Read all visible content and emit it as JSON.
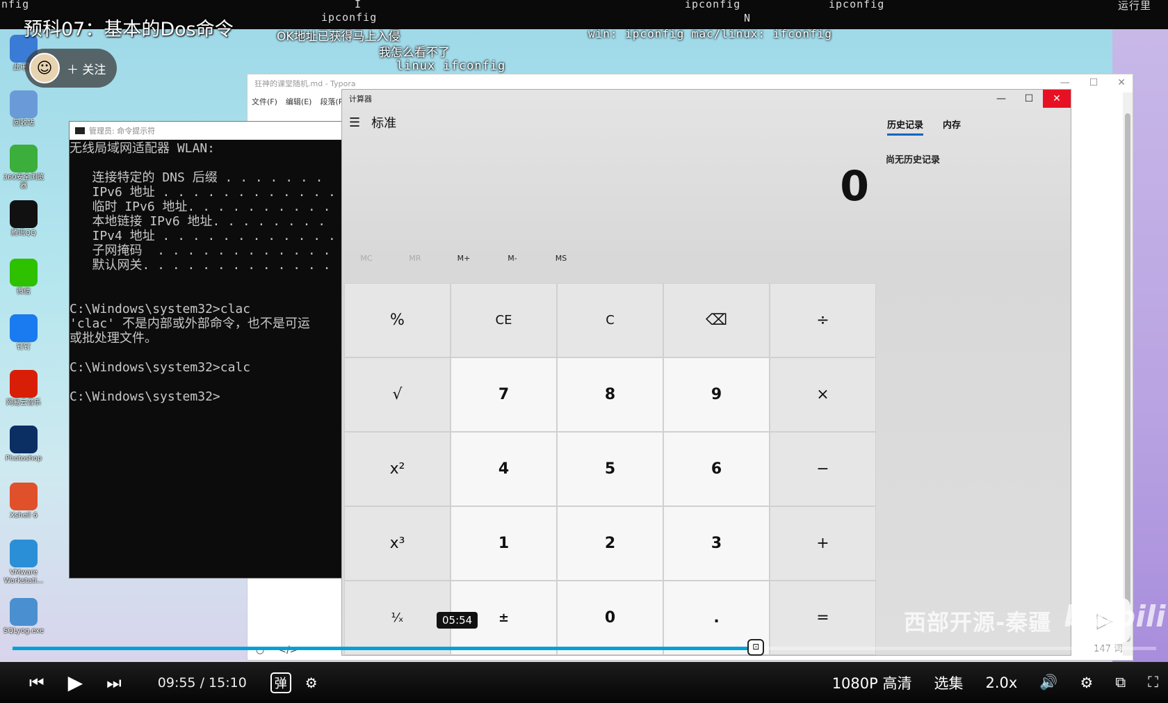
{
  "top_fragments": [
    "nfig",
    "I",
    "ipconfig",
    "ipconfig",
    "N",
    "ipconfig",
    "运行里"
  ],
  "video": {
    "title": "预科07：基本的Dos命令",
    "follow_label": "关注",
    "subtitle_1": "OK地址已获得马上入侵",
    "subtitle_2": "我怎么看不了",
    "subtitle_3": "linux ifconfig",
    "subtitle_4": "win: ipconfig mac/linux: ifconfig"
  },
  "desktop_icons": [
    {
      "label": "此电脑",
      "icon": "computer-icon",
      "color": "#3a7bd5"
    },
    {
      "label": "回收站",
      "icon": "recycle-bin-icon",
      "color": "#6a9bd8"
    },
    {
      "label": "360安全浏览器",
      "icon": "browser-icon",
      "color": "#3cae3c"
    },
    {
      "label": "腾讯QQ",
      "icon": "qq-icon",
      "color": "#111111"
    },
    {
      "label": "微信",
      "icon": "wechat-icon",
      "color": "#2dc100"
    },
    {
      "label": "钉钉",
      "icon": "dingtalk-icon",
      "color": "#1a7af0"
    },
    {
      "label": "网易云音乐",
      "icon": "netease-music-icon",
      "color": "#d81e06"
    },
    {
      "label": "Photoshop",
      "icon": "photoshop-icon",
      "color": "#0b2e63"
    },
    {
      "label": "Xshell 6",
      "icon": "xshell-icon",
      "color": "#e0502a"
    },
    {
      "label": "VMware Workstati...",
      "icon": "vmware-icon",
      "color": "#2a8fd6"
    },
    {
      "label": "SQLyog.exe",
      "icon": "sqlyog-icon",
      "color": "#4a90d0"
    }
  ],
  "typora": {
    "title": "狂神的课堂随机.md - Typora",
    "menu": [
      "文件(F)",
      "编辑(E)",
      "段落(P)"
    ],
    "word_count": "147 词"
  },
  "cmd": {
    "title": "管理员: 命令提示符",
    "lines": [
      "无线局域网适配器 WLAN:",
      "",
      "   连接特定的 DNS 后缀 . . . . . . .",
      "   IPv6 地址 . . . . . . . . . . . .",
      "   临时 IPv6 地址. . . . . . . . . .",
      "   本地链接 IPv6 地址. . . . . . . .",
      "   IPv4 地址 . . . . . . . . . . . .",
      "   子网掩码  . . . . . . . . . . . .",
      "   默认网关. . . . . . . . . . . . .",
      "",
      "",
      "C:\\Windows\\system32>clac",
      "'clac' 不是内部或外部命令，也不是可运",
      "或批处理文件。",
      "",
      "C:\\Windows\\system32>calc",
      "",
      "C:\\Windows\\system32>"
    ]
  },
  "calculator": {
    "window_title": "计算器",
    "mode": "标准",
    "display": "0",
    "memory": [
      "MC",
      "MR",
      "M+",
      "M-",
      "MS"
    ],
    "keys": [
      "%",
      "CE",
      "C",
      "⌫",
      "÷",
      "√",
      "7",
      "8",
      "9",
      "×",
      "x²",
      "4",
      "5",
      "6",
      "−",
      "x³",
      "1",
      "2",
      "3",
      "+",
      "¹⁄ₓ",
      "±",
      "0",
      ".",
      "="
    ],
    "history_tab": "历史记录",
    "memory_tab": "内存",
    "history_empty": "尚无历史记录"
  },
  "watermark": "西部开源-秦疆",
  "watermark_brand": "bilibili",
  "player": {
    "hover_time": "05:54",
    "current": "09:55",
    "separator": "/",
    "total": "15:10",
    "quality": "1080P 高清",
    "episodes": "选集",
    "speed": "2.0x",
    "danmaku": "弹",
    "progress_fraction": 0.65
  }
}
